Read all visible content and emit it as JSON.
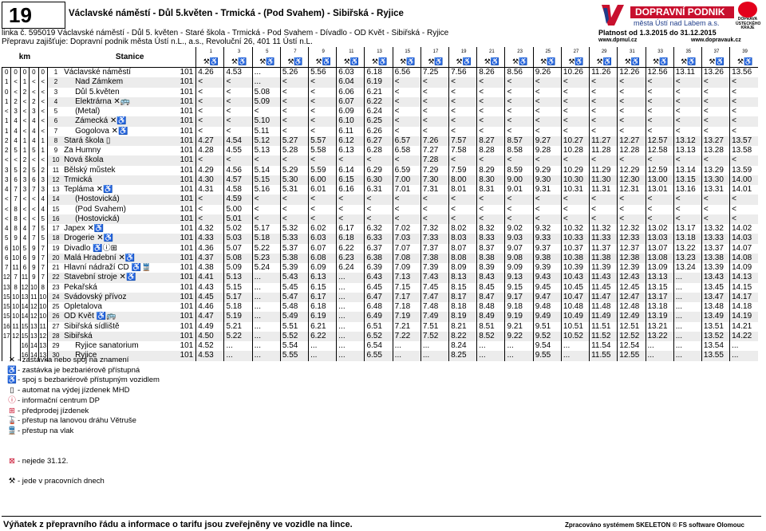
{
  "header": {
    "line_number": "19",
    "title": "Václavské náměstí - Důl 5.květen - Trmická - (Pod Svahem) - Sibiřská - Ryjice",
    "line_info": "linka č. 595019 Václavské náměstí - Důl 5. květen - Staré škola - Trmická - Pod Svahem - Dívadlo - OD Květ - Sibiřská - Ryjice",
    "operator": "Přepravu zajišťuje: Dopravní podnik města Ústí n.L., a.s., Revoluční 26, 401 11 Ústí n.L.",
    "logo_text": "DOPRAVNÍ PODNIK",
    "logo_sub": "města Ústí nad Labem a.s.",
    "right_logo": "DOPRAVA ÚSTECKÉHO KRAJE",
    "validity": "Platnost od 1.3.2015 do 31.12.2015",
    "url_left": "www.dpmul.cz",
    "url_right": "www.dopravauk.cz"
  },
  "columns": {
    "km_label": "km",
    "station_label": "Stanice",
    "trip_numbers": [
      "1",
      "3",
      "5",
      "7",
      "9",
      "11",
      "13",
      "15",
      "17",
      "19",
      "21",
      "23",
      "25",
      "27",
      "29",
      "31",
      "33",
      "35",
      "37",
      "39"
    ]
  },
  "rows": [
    {
      "km": [
        "0",
        "0",
        "0",
        "0",
        "0"
      ],
      "n": "1",
      "name": "Václavské náměstí",
      "sym": "",
      "zone": "101",
      "t": [
        "4.26",
        "4.53",
        "...",
        "5.26",
        "5.56",
        "6.03",
        "6.18",
        "6.56",
        "7.25",
        "7.56",
        "8.26",
        "8.56",
        "9.26",
        "10.26",
        "11.26",
        "12.26",
        "12.56",
        "13.11",
        "13.26",
        "13.56"
      ]
    },
    {
      "km": [
        "",
        "1",
        "<",
        "1",
        "<",
        "<"
      ],
      "n": "2",
      "name": "Nad Zámkem",
      "sym": "",
      "zone": "101",
      "t": [
        "<",
        "<",
        "...",
        "<",
        "<",
        "6.04",
        "6.19",
        "<",
        "<",
        "<",
        "<",
        "<",
        "<",
        "<",
        "<",
        "<",
        "<",
        "<",
        "<",
        "<"
      ]
    },
    {
      "km": [
        "0",
        "<",
        "2",
        "<",
        "<"
      ],
      "n": "3",
      "name": "Důl 5.květen",
      "sym": "",
      "zone": "101",
      "t": [
        "<",
        "<",
        "5.08",
        "<",
        "<",
        "6.06",
        "6.21",
        "<",
        "<",
        "<",
        "<",
        "<",
        "<",
        "<",
        "<",
        "<",
        "<",
        "<",
        "<",
        "<"
      ]
    },
    {
      "km": [
        "1",
        "2",
        "<",
        "2",
        "<"
      ],
      "n": "4",
      "name": "Elektrárna ✕🚌",
      "sym": "",
      "zone": "101",
      "t": [
        "<",
        "<",
        "5.09",
        "<",
        "<",
        "6.07",
        "6.22",
        "<",
        "<",
        "<",
        "<",
        "<",
        "<",
        "<",
        "<",
        "<",
        "<",
        "<",
        "<",
        "<"
      ]
    },
    {
      "km": [
        "<",
        "3",
        "<",
        "3",
        "<"
      ],
      "n": "5",
      "name": "(Metal)",
      "sym": "",
      "zone": "101",
      "t": [
        "<",
        "<",
        "<",
        "<",
        "<",
        "6.09",
        "6.24",
        "<",
        "<",
        "<",
        "<",
        "<",
        "<",
        "<",
        "<",
        "<",
        "<",
        "<",
        "<",
        "<"
      ]
    },
    {
      "km": [
        "1",
        "4",
        "<",
        "4",
        "<"
      ],
      "n": "6",
      "name": "Zámecká ✕♿",
      "sym": "",
      "zone": "101",
      "t": [
        "<",
        "<",
        "5.10",
        "<",
        "<",
        "6.10",
        "6.25",
        "<",
        "<",
        "<",
        "<",
        "<",
        "<",
        "<",
        "<",
        "<",
        "<",
        "<",
        "<",
        "<"
      ]
    },
    {
      "km": [
        "1",
        "4",
        "<",
        "4",
        "<"
      ],
      "n": "7",
      "name": "Gogolova ✕♿",
      "sym": "",
      "zone": "101",
      "t": [
        "<",
        "<",
        "5.11",
        "<",
        "<",
        "6.11",
        "6.26",
        "<",
        "<",
        "<",
        "<",
        "<",
        "<",
        "<",
        "<",
        "<",
        "<",
        "<",
        "<",
        "<"
      ]
    },
    {
      "km": [
        "2",
        "4",
        "1",
        "4",
        "1"
      ],
      "n": "8",
      "name": "Stará škola ▯",
      "sym": "",
      "zone": "101",
      "t": [
        "4.27",
        "4.54",
        "5.12",
        "5.27",
        "5.57",
        "6.12",
        "6.27",
        "6.57",
        "7.26",
        "7.57",
        "8.27",
        "8.57",
        "9.27",
        "10.27",
        "11.27",
        "12.27",
        "12.57",
        "13.12",
        "13.27",
        "13.57"
      ]
    },
    {
      "km": [
        "2",
        "5",
        "1",
        "5",
        "1"
      ],
      "n": "9",
      "name": "Za Humny",
      "sym": "",
      "zone": "101",
      "t": [
        "4.28",
        "4.55",
        "5.13",
        "5.28",
        "5.58",
        "6.13",
        "6.28",
        "6.58",
        "7.27",
        "7.58",
        "8.28",
        "8.58",
        "9.28",
        "10.28",
        "11.28",
        "12.28",
        "12.58",
        "13.13",
        "13.28",
        "13.58"
      ]
    },
    {
      "km": [
        "<",
        "<",
        "2",
        "<",
        "<"
      ],
      "n": "10",
      "name": "Nová škola",
      "sym": "",
      "zone": "101",
      "t": [
        "<",
        "<",
        "<",
        "<",
        "<",
        "<",
        "<",
        "<",
        "7.28",
        "<",
        "<",
        "<",
        "<",
        "<",
        "<",
        "<",
        "<",
        "<",
        "<",
        "<"
      ]
    },
    {
      "km": [
        "3",
        "5",
        "2",
        "5",
        "2"
      ],
      "n": "11",
      "name": "Bělský můstek",
      "sym": "",
      "zone": "101",
      "t": [
        "4.29",
        "4.56",
        "5.14",
        "5.29",
        "5.59",
        "6.14",
        "6.29",
        "6.59",
        "7.29",
        "7.59",
        "8.29",
        "8.59",
        "9.29",
        "10.29",
        "11.29",
        "12.29",
        "12.59",
        "13.14",
        "13.29",
        "13.59"
      ]
    },
    {
      "km": [
        "3",
        "6",
        "3",
        "6",
        "3"
      ],
      "n": "12",
      "name": "Trmická",
      "sym": "",
      "zone": "101",
      "t": [
        "4.30",
        "4.57",
        "5.15",
        "5.30",
        "6.00",
        "6.15",
        "6.30",
        "7.00",
        "7.30",
        "8.00",
        "8.30",
        "9.00",
        "9.30",
        "10.30",
        "11.30",
        "12.30",
        "13.00",
        "13.15",
        "13.30",
        "14.00"
      ]
    },
    {
      "km": [
        "4",
        "7",
        "3",
        "7",
        "3"
      ],
      "n": "13",
      "name": "Tepláma ✕♿",
      "sym": "",
      "zone": "101",
      "t": [
        "4.31",
        "4.58",
        "5.16",
        "5.31",
        "6.01",
        "6.16",
        "6.31",
        "7.01",
        "7.31",
        "8.01",
        "8.31",
        "9.01",
        "9.31",
        "10.31",
        "11.31",
        "12.31",
        "13.01",
        "13.16",
        "13.31",
        "14.01"
      ]
    },
    {
      "km": [
        "<",
        "7",
        "<",
        "<",
        "4"
      ],
      "n": "14",
      "name": "(Hostovická)",
      "sym": "",
      "zone": "101",
      "t": [
        "<",
        "4.59",
        "<",
        "<",
        "<",
        "<",
        "<",
        "<",
        "<",
        "<",
        "<",
        "<",
        "<",
        "<",
        "<",
        "<",
        "<",
        "<",
        "<",
        "<"
      ]
    },
    {
      "km": [
        "<",
        "8",
        "<",
        "<",
        "4"
      ],
      "n": "15",
      "name": "(Pod Svahem)",
      "sym": "",
      "zone": "101",
      "t": [
        "<",
        "5.00",
        "<",
        "<",
        "<",
        "<",
        "<",
        "<",
        "<",
        "<",
        "<",
        "<",
        "<",
        "<",
        "<",
        "<",
        "<",
        "<",
        "<",
        "<"
      ]
    },
    {
      "km": [
        "<",
        "8",
        "<",
        "<",
        "5"
      ],
      "n": "16",
      "name": "(Hostovická)",
      "sym": "",
      "zone": "101",
      "t": [
        "<",
        "5.01",
        "<",
        "<",
        "<",
        "<",
        "<",
        "<",
        "<",
        "<",
        "<",
        "<",
        "<",
        "<",
        "<",
        "<",
        "<",
        "<",
        "<",
        "<"
      ]
    },
    {
      "km": [
        "4",
        "8",
        "4",
        "7",
        "5"
      ],
      "n": "17",
      "name": "Japex ✕♿",
      "sym": "",
      "zone": "101",
      "t": [
        "4.32",
        "5.02",
        "5.17",
        "5.32",
        "6.02",
        "6.17",
        "6.32",
        "7.02",
        "7.32",
        "8.02",
        "8.32",
        "9.02",
        "9.32",
        "10.32",
        "11.32",
        "12.32",
        "13.02",
        "13.17",
        "13.32",
        "14.02"
      ]
    },
    {
      "km": [
        "5",
        "9",
        "4",
        "7",
        "5"
      ],
      "n": "18",
      "name": "Drogerie ✕♿",
      "sym": "",
      "zone": "101",
      "t": [
        "4.33",
        "5.03",
        "5.18",
        "5.33",
        "6.03",
        "6.18",
        "6.33",
        "7.03",
        "7.33",
        "8.03",
        "8.33",
        "9.03",
        "9.33",
        "10.33",
        "11.33",
        "12.33",
        "13.03",
        "13.18",
        "13.33",
        "14.03"
      ]
    },
    {
      "km": [
        "6",
        "10",
        "5",
        "9",
        "7"
      ],
      "n": "19",
      "name": "Divadlo ♿ⓘ⊞",
      "sym": "",
      "zone": "101",
      "t": [
        "4.36",
        "5.07",
        "5.22",
        "5.37",
        "6.07",
        "6.22",
        "6.37",
        "7.07",
        "7.37",
        "8.07",
        "8.37",
        "9.07",
        "9.37",
        "10.37",
        "11.37",
        "12.37",
        "13.07",
        "13.22",
        "13.37",
        "14.07"
      ]
    },
    {
      "km": [
        "6",
        "10",
        "6",
        "9",
        "7"
      ],
      "n": "20",
      "name": "Malá Hradební ✕♿",
      "sym": "",
      "zone": "101",
      "t": [
        "4.37",
        "5.08",
        "5.23",
        "5.38",
        "6.08",
        "6.23",
        "6.38",
        "7.08",
        "7.38",
        "8.08",
        "8.38",
        "9.08",
        "9.38",
        "10.38",
        "11.38",
        "12.38",
        "13.08",
        "13.23",
        "13.38",
        "14.08"
      ]
    },
    {
      "km": [
        "7",
        "11",
        "6",
        "9",
        "7"
      ],
      "n": "21",
      "name": "Hlavní nádraží CD ♿🚆",
      "sym": "",
      "zone": "101",
      "t": [
        "4.38",
        "5.09",
        "5.24",
        "5.39",
        "6.09",
        "6.24",
        "6.39",
        "7.09",
        "7.39",
        "8.09",
        "8.39",
        "9.09",
        "9.39",
        "10.39",
        "11.39",
        "12.39",
        "13.09",
        "13.24",
        "13.39",
        "14.09"
      ]
    },
    {
      "km": [
        "",
        "12",
        "7",
        "11",
        "9",
        "7"
      ],
      "n": "22",
      "name": "Stavební stroje ✕♿",
      "sym": "",
      "zone": "101",
      "t": [
        "4.41",
        "5.13",
        "...",
        "5.43",
        "6.13",
        "...",
        "6.43",
        "7.13",
        "7.43",
        "8.13",
        "8.43",
        "9.13",
        "9.43",
        "10.43",
        "11.43",
        "12.43",
        "13.13",
        "...",
        "13.43",
        "14.13"
      ]
    },
    {
      "km": [
        "",
        "13",
        "8",
        "12",
        "10",
        "8"
      ],
      "n": "23",
      "name": "Pekařská",
      "sym": "",
      "zone": "101",
      "t": [
        "4.43",
        "5.15",
        "...",
        "5.45",
        "6.15",
        "...",
        "6.45",
        "7.15",
        "7.45",
        "8.15",
        "8.45",
        "9.15",
        "9.45",
        "10.45",
        "11.45",
        "12.45",
        "13.15",
        "...",
        "13.45",
        "14.15"
      ]
    },
    {
      "km": [
        "",
        "15",
        "10",
        "13",
        "11",
        "10"
      ],
      "n": "24",
      "name": "Svádovský přívoz",
      "sym": "",
      "zone": "101",
      "t": [
        "4.45",
        "5.17",
        "...",
        "5.47",
        "6.17",
        "...",
        "6.47",
        "7.17",
        "7.47",
        "8.17",
        "8.47",
        "9.17",
        "9.47",
        "10.47",
        "11.47",
        "12.47",
        "13.17",
        "...",
        "13.47",
        "14.17"
      ]
    },
    {
      "km": [
        "",
        "15",
        "10",
        "14",
        "12",
        "10"
      ],
      "n": "25",
      "name": "Opletalova",
      "sym": "",
      "zone": "101",
      "t": [
        "4.46",
        "5.18",
        "...",
        "5.48",
        "6.18",
        "...",
        "6.48",
        "7.18",
        "7.48",
        "8.18",
        "8.48",
        "9.18",
        "9.48",
        "10.48",
        "11.48",
        "12.48",
        "13.18",
        "...",
        "13.48",
        "14.18"
      ]
    },
    {
      "km": [
        "",
        "15",
        "10",
        "14",
        "12",
        "10"
      ],
      "n": "26",
      "name": "OD Květ ♿🚌",
      "sym": "",
      "zone": "101",
      "t": [
        "4.47",
        "5.19",
        "...",
        "5.49",
        "6.19",
        "...",
        "6.49",
        "7.19",
        "7.49",
        "8.19",
        "8.49",
        "9.19",
        "9.49",
        "10.49",
        "11.49",
        "12.49",
        "13.19",
        "...",
        "13.49",
        "14.19"
      ]
    },
    {
      "km": [
        "",
        "16",
        "11",
        "15",
        "13",
        "11"
      ],
      "n": "27",
      "name": "Sibiřská sídliště",
      "sym": "",
      "zone": "101",
      "t": [
        "4.49",
        "5.21",
        "...",
        "5.51",
        "6.21",
        "...",
        "6.51",
        "7.21",
        "7.51",
        "8.21",
        "8.51",
        "9.21",
        "9.51",
        "10.51",
        "11.51",
        "12.51",
        "13.21",
        "...",
        "13.51",
        "14.21"
      ]
    },
    {
      "km": [
        "",
        "17",
        "12",
        "15",
        "13",
        "12"
      ],
      "n": "28",
      "name": "Sibiřská",
      "sym": "",
      "zone": "101",
      "t": [
        "4.50",
        "5.22",
        "...",
        "5.52",
        "6.22",
        "...",
        "6.52",
        "7.22",
        "7.52",
        "8.22",
        "8.52",
        "9.22",
        "9.52",
        "10.52",
        "11.52",
        "12.52",
        "13.22",
        "...",
        "13.52",
        "14.22"
      ]
    },
    {
      "km": [
        "",
        "",
        "",
        "16",
        "14",
        "13"
      ],
      "n": "29",
      "name": "Ryjice sanatorium",
      "sym": "",
      "zone": "101",
      "t": [
        "4.52",
        "...",
        "...",
        "5.54",
        "...",
        "...",
        "6.54",
        "...",
        "...",
        "8.24",
        "...",
        "...",
        "9.54",
        "...",
        "11.54",
        "12.54",
        "...",
        "...",
        "13.54",
        "..."
      ]
    },
    {
      "km": [
        "",
        "",
        "",
        "16",
        "14",
        "13"
      ],
      "n": "30",
      "name": "Ryjice",
      "sym": "",
      "zone": "101",
      "t": [
        "4.53",
        "...",
        "...",
        "5.55",
        "...",
        "...",
        "6.55",
        "...",
        "...",
        "8.25",
        "...",
        "...",
        "9.55",
        "...",
        "11.55",
        "12.55",
        "...",
        "...",
        "13.55",
        "..."
      ]
    }
  ],
  "legend": [
    {
      "icon": "✕",
      "text": "- zastávka nebo spoj na znamení"
    },
    {
      "icon": "♿",
      "text": "- zastávka je bezbariérově přístupná"
    },
    {
      "icon": "♿",
      "text": "- spoj s bezbariérově přístupným vozidlem"
    },
    {
      "icon": "▯",
      "text": "- automat na výdej jízdenek MHD"
    },
    {
      "icon": "ⓘ",
      "text": "- informační centrum DP"
    },
    {
      "icon": "⊞",
      "text": "- předprodej jízdenek"
    },
    {
      "icon": "🚡",
      "text": "- přestup na lanovou dráhu Větruše"
    },
    {
      "icon": "🚆",
      "text": "- přestup na vlak"
    },
    {
      "icon": "",
      "text": ""
    },
    {
      "icon": "",
      "text": ""
    },
    {
      "icon": "⊠",
      "text": "- nejede 31.12."
    },
    {
      "icon": "",
      "text": ""
    },
    {
      "icon": "⚒",
      "text": "- jede v pracovních dnech"
    }
  ],
  "footer": {
    "left": "Výňatek z přepravního řádu a informace o tarifu jsou zveřejněny ve vozidle na lince.",
    "right": "Zpracováno systémem SKELETON © FS software Olomouc"
  }
}
